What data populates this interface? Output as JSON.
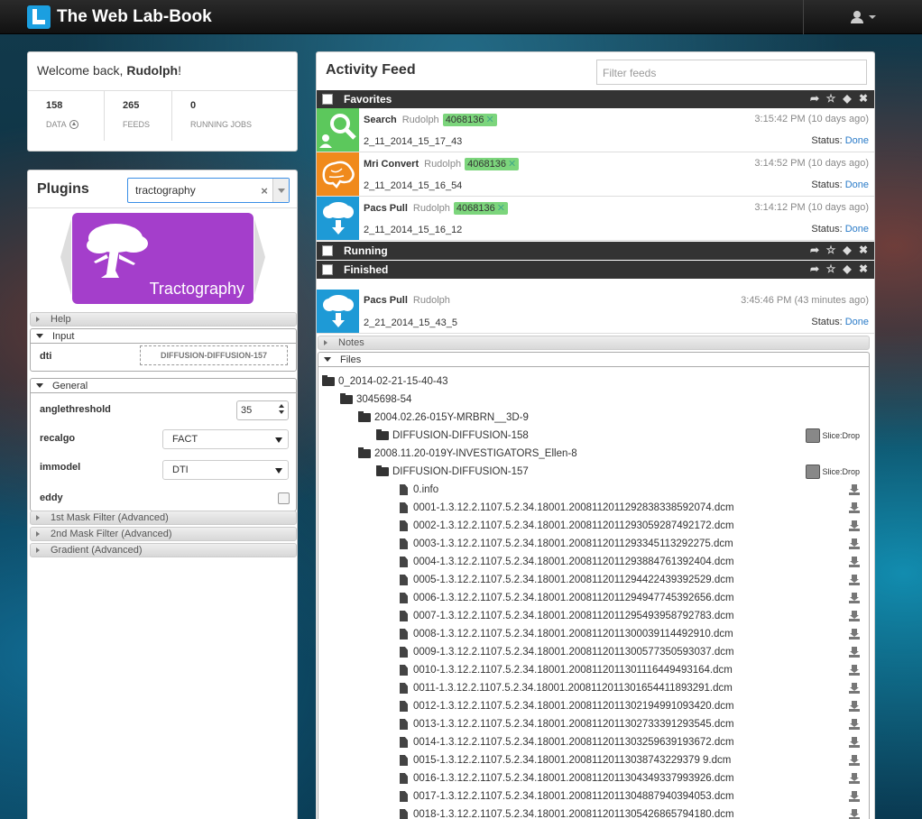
{
  "app": {
    "title": "The Web Lab-Book"
  },
  "welcome": {
    "greeting_prefix": "Welcome back, ",
    "user": "Rudolph",
    "greeting_suffix": "!",
    "stats": [
      {
        "value": "158",
        "label": "DATA"
      },
      {
        "value": "265",
        "label": "FEEDS"
      },
      {
        "value": "0",
        "label": "RUNNING JOBS"
      }
    ]
  },
  "plugins": {
    "title": "Plugins",
    "search_value": "tractography",
    "selected_plugin": "Tractography",
    "sections": {
      "help": "Help",
      "input": "Input",
      "general": "General",
      "mask1": "1st Mask Filter (Advanced)",
      "mask2": "2nd Mask Filter (Advanced)",
      "gradient": "Gradient (Advanced)"
    },
    "input": {
      "label": "dti",
      "value": "DIFFUSION-DIFFUSION-157"
    },
    "general": {
      "anglethreshold": {
        "label": "anglethreshold",
        "value": "35"
      },
      "recalgo": {
        "label": "recalgo",
        "value": "FACT"
      },
      "immodel": {
        "label": "immodel",
        "value": "DTI"
      },
      "eddy": {
        "label": "eddy"
      }
    }
  },
  "feed": {
    "title": "Activity Feed",
    "filter_placeholder": "Filter feeds",
    "groups": {
      "favorites": "Favorites",
      "running": "Running",
      "finished": "Finished"
    },
    "favorites": [
      {
        "name": "Search",
        "user": "Rudolph",
        "tag": "4068136",
        "time": "3:15:42 PM (10 days ago)",
        "id": "2_11_2014_15_17_43",
        "status_label": "Status:",
        "status": "Done",
        "color": "#5cc85c"
      },
      {
        "name": "Mri Convert",
        "user": "Rudolph",
        "tag": "4068136",
        "time": "3:14:52 PM (10 days ago)",
        "id": "2_11_2014_15_16_54",
        "status_label": "Status:",
        "status": "Done",
        "color": "#f08a1c"
      },
      {
        "name": "Pacs Pull",
        "user": "Rudolph",
        "tag": "4068136",
        "time": "3:14:12 PM (10 days ago)",
        "id": "2_11_2014_15_16_12",
        "status_label": "Status:",
        "status": "Done",
        "color": "#1e9ad6"
      }
    ],
    "finished": [
      {
        "name": "Pacs Pull",
        "user": "Rudolph",
        "time": "3:45:46 PM (43 minutes ago)",
        "id": "2_21_2014_15_43_5",
        "status_label": "Status:",
        "status": "Done",
        "color": "#1e9ad6"
      }
    ],
    "notes_label": "Notes",
    "files_label": "Files",
    "slicedrop_label": "Slice:Drop",
    "tree": {
      "root": "0_2014-02-21-15-40-43",
      "sub": "3045698-54",
      "series1": "2004.02.26-015Y-MRBRN__3D-9",
      "series1_child": "DIFFUSION-DIFFUSION-158",
      "series2": "2008.11.20-019Y-INVESTIGATORS_Ellen-8",
      "series2_child": "DIFFUSION-DIFFUSION-157",
      "files": [
        "0.info",
        "0001-1.3.12.2.1107.5.2.34.18001.2008112011292838338592074.dcm",
        "0002-1.3.12.2.1107.5.2.34.18001.2008112011293059287492172.dcm",
        "0003-1.3.12.2.1107.5.2.34.18001.2008112011293345113292275.dcm",
        "0004-1.3.12.2.1107.5.2.34.18001.2008112011293884761392404.dcm",
        "0005-1.3.12.2.1107.5.2.34.18001.2008112011294422439392529.dcm",
        "0006-1.3.12.2.1107.5.2.34.18001.2008112011294947745392656.dcm",
        "0007-1.3.12.2.1107.5.2.34.18001.2008112011295493958792783.dcm",
        "0008-1.3.12.2.1107.5.2.34.18001.2008112011300039114492910.dcm",
        "0009-1.3.12.2.1107.5.2.34.18001.2008112011300577350593037.dcm",
        "0010-1.3.12.2.1107.5.2.34.18001.2008112011301116449493164.dcm",
        "0011-1.3.12.2.1107.5.2.34.18001.2008112011301654411893291.dcm",
        "0012-1.3.12.2.1107.5.2.34.18001.2008112011302194991093420.dcm",
        "0013-1.3.12.2.1107.5.2.34.18001.2008112011302733391293545.dcm",
        "0014-1.3.12.2.1107.5.2.34.18001.2008112011303259639193672.dcm",
        "0015-1.3.12.2.1107.5.2.34.18001.20081120113038743229379 9.dcm",
        "0016-1.3.12.2.1107.5.2.34.18001.2008112011304349337993926.dcm",
        "0017-1.3.12.2.1107.5.2.34.18001.2008112011304887940394053.dcm",
        "0018-1.3.12.2.1107.5.2.34.18001.2008112011305426865794180.dcm"
      ]
    }
  }
}
